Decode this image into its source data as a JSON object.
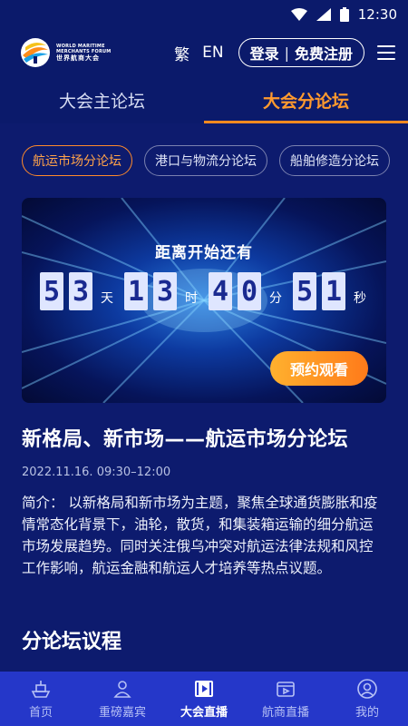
{
  "status_bar": {
    "time": "12:30"
  },
  "header": {
    "logo_en": [
      "WORLD MARITIME",
      "MERCHANTS FORUM"
    ],
    "logo_cn": "世界航商大会",
    "lang_traditional": "繁",
    "lang_english": "EN",
    "login_label": "登录",
    "auth_separator": "|",
    "register_label": "免费注册"
  },
  "tabs": [
    {
      "label": "大会主论坛",
      "active": false
    },
    {
      "label": "大会分论坛",
      "active": true
    }
  ],
  "chips": [
    {
      "label": "航运市场分论坛",
      "active": true
    },
    {
      "label": "港口与物流分论坛",
      "active": false
    },
    {
      "label": "船舶修造分论坛",
      "active": false
    }
  ],
  "banner": {
    "countdown_title": "距离开始还有",
    "days": "53",
    "days_unit": "天",
    "hours": "13",
    "hours_unit": "时",
    "minutes": "40",
    "minutes_unit": "分",
    "seconds": "51",
    "seconds_unit": "秒",
    "reserve_label": "预约观看"
  },
  "forum": {
    "title": "新格局、新市场——航运市场分论坛",
    "date": "2022.11.16. 09:30–12:00",
    "description": "简介： 以新格局和新市场为主题，聚焦全球通货膨胀和疫情常态化背景下，油轮，散货，和集装箱运输的细分航运市场发展趋势。同时关注俄乌冲突对航运法律法规和风控工作影响，航运金融和航运人才培养等热点议题。",
    "agenda_title": "分论坛议程"
  },
  "bottom_nav": [
    {
      "label": "首页",
      "icon": "ship-icon",
      "active": false
    },
    {
      "label": "重磅嘉宾",
      "icon": "guest-icon",
      "active": false
    },
    {
      "label": "大会直播",
      "icon": "live-icon",
      "active": true
    },
    {
      "label": "航商直播",
      "icon": "video-icon",
      "active": false
    },
    {
      "label": "我的",
      "icon": "profile-icon",
      "active": false
    }
  ],
  "colors": {
    "background": "#0b1a6b",
    "accent": "#ff8a1f",
    "nav": "#2537c9"
  }
}
